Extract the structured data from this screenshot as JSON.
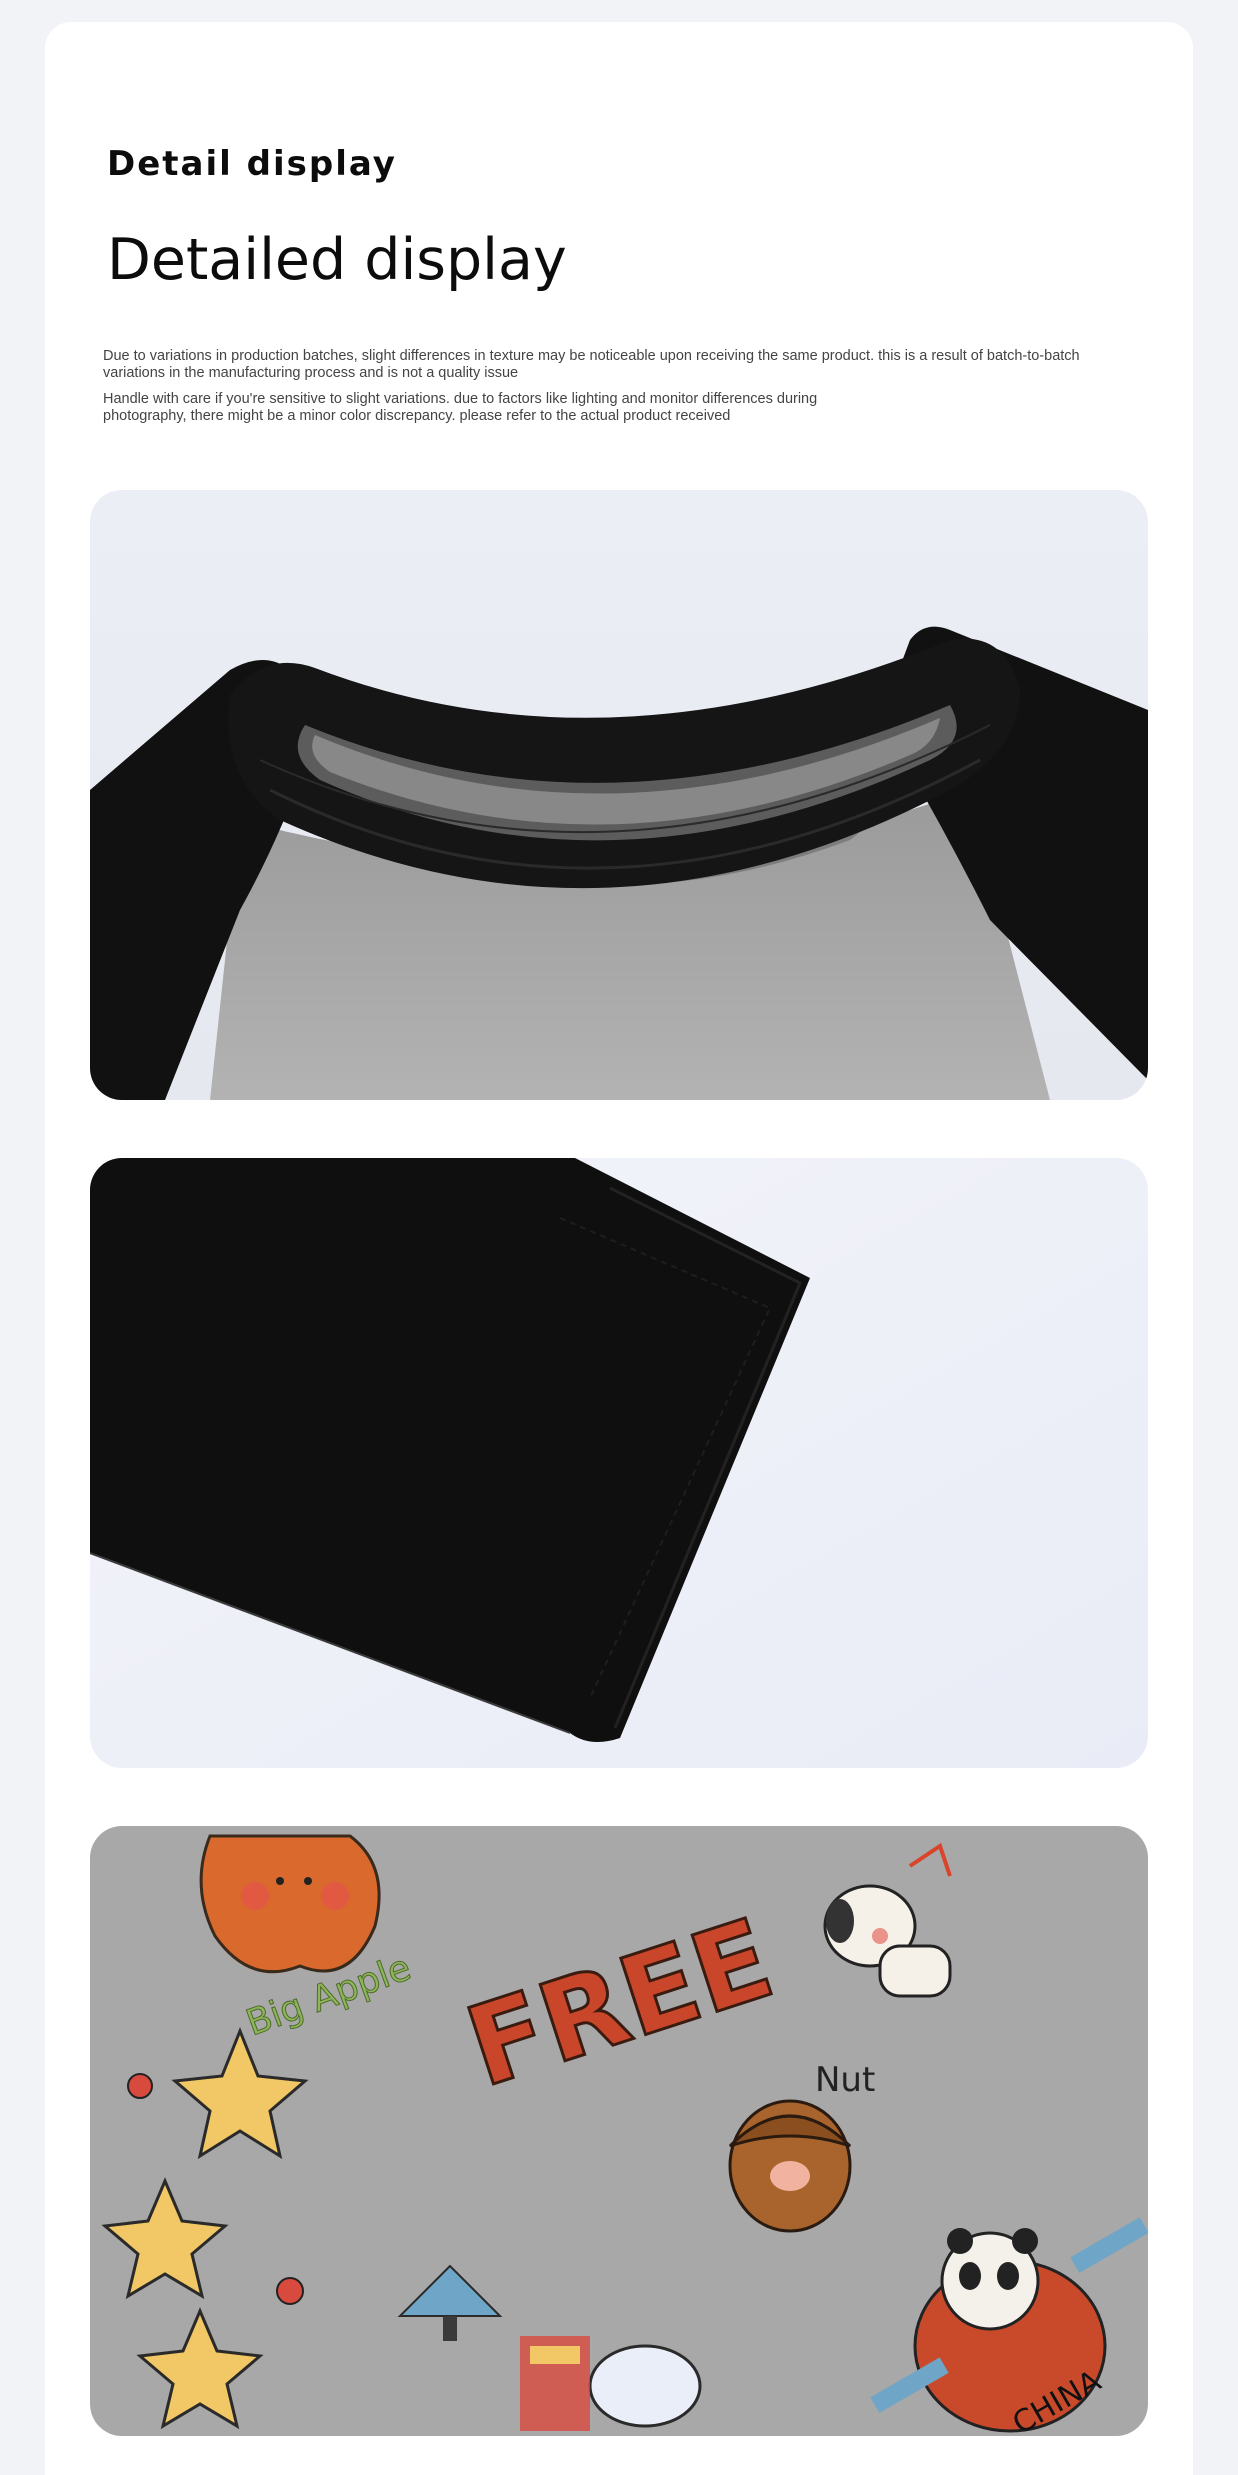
{
  "header": {
    "title": "Detail display",
    "subtitle": "Detailed display"
  },
  "notes": [
    "Due to variations in production batches, slight differences in texture may be noticeable upon receiving the same product. this is a result of batch-to-batch variations in the manufacturing process and is not a quality issue",
    "Handle with care if you're sensitive to slight variations. due to factors like lighting and monitor differences during photography, there might be a minor color discrepancy. please refer to the actual product received"
  ],
  "photos": [
    {
      "subject": "collar-detail"
    },
    {
      "subject": "sleeve-cuff-detail"
    },
    {
      "subject": "print-pattern-detail"
    }
  ],
  "print_texts": [
    "Big Apple",
    "FREE",
    "Nut",
    "CHINA"
  ],
  "colors": {
    "page_bg": "#f2f3f7",
    "fabric_black": "#101010",
    "fabric_grey": "#a7a7a7",
    "backdrop": "#eef0f7"
  }
}
